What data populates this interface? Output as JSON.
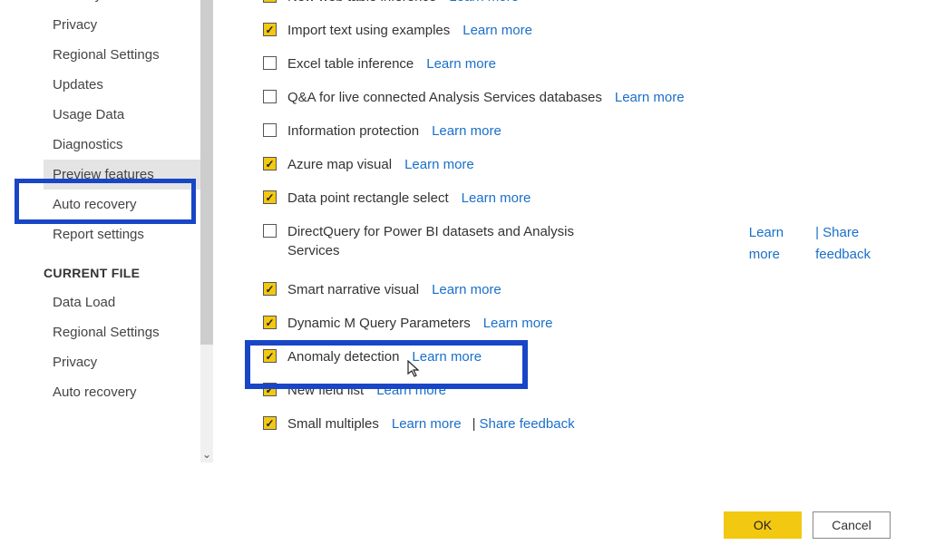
{
  "sidebar": {
    "items": [
      {
        "label": "Security"
      },
      {
        "label": "Privacy"
      },
      {
        "label": "Regional Settings"
      },
      {
        "label": "Updates"
      },
      {
        "label": "Usage Data"
      },
      {
        "label": "Diagnostics"
      },
      {
        "label": "Preview features"
      },
      {
        "label": "Auto recovery"
      },
      {
        "label": "Report settings"
      }
    ],
    "section_header": "CURRENT FILE",
    "file_items": [
      {
        "label": "Data Load"
      },
      {
        "label": "Regional Settings"
      },
      {
        "label": "Privacy"
      },
      {
        "label": "Auto recovery"
      }
    ]
  },
  "features": [
    {
      "checked": true,
      "label": "New web table inference",
      "links": [
        "Learn more"
      ],
      "cutoff": true
    },
    {
      "checked": true,
      "label": "Import text using examples",
      "links": [
        "Learn more"
      ]
    },
    {
      "checked": false,
      "label": "Excel table inference",
      "links": [
        "Learn more"
      ]
    },
    {
      "checked": false,
      "label": "Q&A for live connected Analysis Services databases",
      "links": [
        "Learn more"
      ]
    },
    {
      "checked": false,
      "label": "Information protection",
      "links": [
        "Learn more"
      ]
    },
    {
      "checked": true,
      "label": "Azure map visual",
      "links": [
        "Learn more"
      ]
    },
    {
      "checked": true,
      "label": "Data point rectangle select",
      "links": [
        "Learn more"
      ]
    },
    {
      "checked": false,
      "label": "DirectQuery for Power BI datasets and Analysis Services",
      "links": [],
      "wrap": true,
      "rightLinks": {
        "col1": [
          "Learn",
          "more"
        ],
        "col2": [
          "| Share",
          "feedback"
        ]
      }
    },
    {
      "checked": true,
      "label": "Smart narrative visual",
      "links": [
        "Learn more"
      ]
    },
    {
      "checked": true,
      "label": "Dynamic M Query Parameters",
      "links": [
        "Learn more"
      ]
    },
    {
      "checked": true,
      "label": "Anomaly detection",
      "links": [
        "Learn more"
      ]
    },
    {
      "checked": true,
      "label": "New field list",
      "links": [
        "Learn more"
      ]
    },
    {
      "checked": true,
      "label": "Small multiples",
      "links": [
        "Learn more",
        "|",
        "Share feedback"
      ]
    }
  ],
  "buttons": {
    "ok": "OK",
    "cancel": "Cancel"
  }
}
